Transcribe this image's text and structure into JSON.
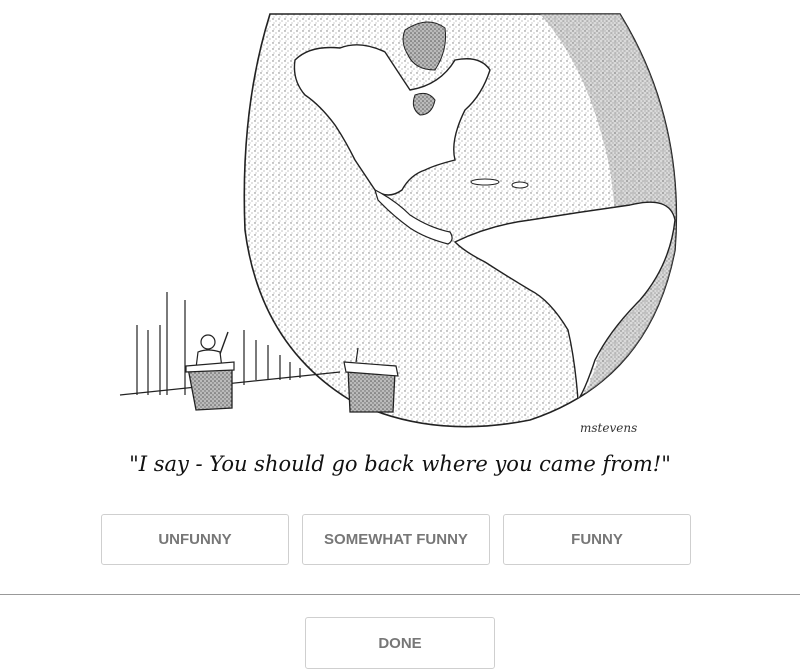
{
  "cartoon": {
    "signature": "mstevens",
    "caption": "\"I say - You should go back where you came from!\""
  },
  "ratings": [
    {
      "label": "UNFUNNY"
    },
    {
      "label": "SOMEWHAT FUNNY"
    },
    {
      "label": "FUNNY"
    }
  ],
  "done_label": "DONE",
  "colors": {
    "button_border": "#cfcfcf",
    "button_text": "#777777",
    "divider": "#999999"
  }
}
